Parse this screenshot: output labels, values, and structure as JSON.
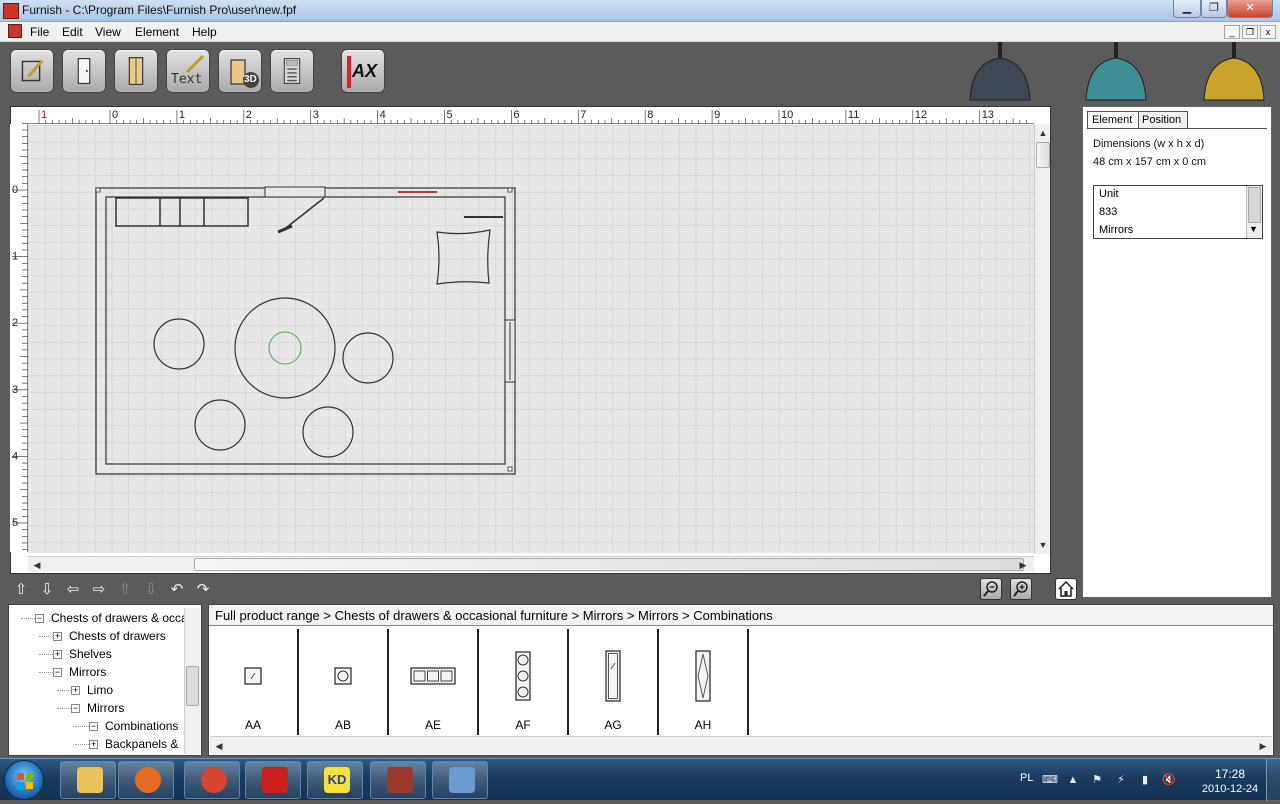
{
  "window": {
    "title": "Furnish - C:\\Program Files\\Furnish Pro\\user\\new.fpf",
    "min_glyph": "▁",
    "max_glyph": "❐",
    "close_glyph": "✕"
  },
  "menu": {
    "file": "File",
    "edit": "Edit",
    "view": "View",
    "element": "Element",
    "help": "Help"
  },
  "toolbar": {
    "text_tool_label": "Text",
    "badge_3d": "3D",
    "ax_label": "AX",
    "lamp_colors": [
      "#3e4754",
      "#3f8f96",
      "#c9a32a"
    ]
  },
  "rulers": {
    "top_ticks": [
      "1",
      "0",
      "1",
      "2",
      "3",
      "4",
      "5",
      "6",
      "7",
      "8",
      "9",
      "10",
      "11",
      "12",
      "13"
    ],
    "left_ticks": [
      "0",
      "1",
      "2",
      "3",
      "4",
      "5"
    ]
  },
  "side_panel": {
    "tab_element": "Element",
    "tab_position": "Position",
    "dimensions_label": "Dimensions (w x h x d)",
    "dimensions_value": "48 cm x 157 cm x 0 cm",
    "unit_list": [
      "Unit",
      "833",
      "Mirrors"
    ]
  },
  "tree": {
    "items": [
      {
        "label": "Chests of drawers & occa",
        "state": "−"
      },
      {
        "label": "Chests of drawers",
        "state": "+"
      },
      {
        "label": "Shelves",
        "state": "+"
      },
      {
        "label": "Mirrors",
        "state": "−"
      },
      {
        "label": "Limo",
        "state": "+"
      },
      {
        "label": "Mirrors",
        "state": "−"
      },
      {
        "label": "Combinations",
        "state": "−"
      },
      {
        "label": "Backpanels &",
        "state": "+"
      }
    ]
  },
  "breadcrumb": "Full product range > Chests of drawers & occasional furniture > Mirrors > Mirrors > Combinations",
  "products": [
    {
      "code": "AA"
    },
    {
      "code": "AB"
    },
    {
      "code": "AE"
    },
    {
      "code": "AF"
    },
    {
      "code": "AG"
    },
    {
      "code": "AH"
    }
  ],
  "taskbar": {
    "apps": [
      {
        "name": "explorer",
        "color": "#e9c35a"
      },
      {
        "name": "media-player",
        "color": "#e46b21"
      },
      {
        "name": "chrome",
        "color": "#d84532"
      },
      {
        "name": "splash-app",
        "color": "#cc1f1f"
      },
      {
        "name": "kd-app",
        "label": "KD",
        "color": "#2d3ca8"
      },
      {
        "name": "furnish-app",
        "color": "#9b3a2a"
      },
      {
        "name": "control-panel",
        "color": "#6b9bd1"
      }
    ],
    "language": "PL",
    "time": "17:28",
    "date": "2010-12-24"
  }
}
